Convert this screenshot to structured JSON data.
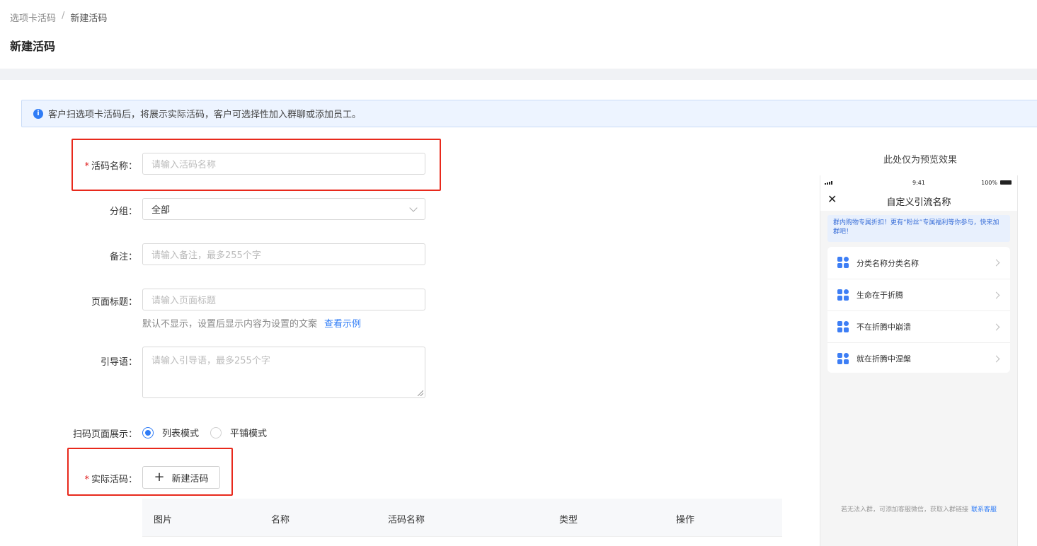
{
  "breadcrumb": {
    "parent": "选项卡活码",
    "separator": "/",
    "current": "新建活码"
  },
  "page_title": "新建活码",
  "banner": {
    "icon": "info-icon",
    "text": "客户扫选项卡活码后，将展示实际活码，客户可选择性加入群聊或添加员工。"
  },
  "form": {
    "name": {
      "label": "活码名称",
      "placeholder": "请输入活码名称",
      "required": true
    },
    "group": {
      "label": "分组",
      "value": "全部"
    },
    "remark": {
      "label": "备注",
      "placeholder": "请输入备注，最多255个字"
    },
    "page_title": {
      "label": "页面标题",
      "placeholder": "请输入页面标题",
      "hint": "默认不显示，设置后显示内容为设置的文案",
      "hint_link": "查看示例"
    },
    "guide": {
      "label": "引导语",
      "placeholder": "请输入引导语，最多255个字"
    },
    "display_mode": {
      "label": "扫码页面展示",
      "options": [
        "列表模式",
        "平铺模式"
      ],
      "selected": "列表模式"
    },
    "actual_code": {
      "label": "实际活码",
      "button": "新建活码",
      "required": true
    },
    "colon": "："
  },
  "table": {
    "columns": [
      "图片",
      "名称",
      "活码名称",
      "类型",
      "操作"
    ]
  },
  "preview": {
    "caption": "此处仅为预览效果",
    "status_time": "9:41",
    "status_battery": "100%",
    "title": "自定义引流名称",
    "banner": "群内购物专属折扣！更有“粉丝”专属福利等你参与，快来加群吧！",
    "items": [
      "分类名称分类名称",
      "生命在于折腾",
      "不在折腾中崩溃",
      "就在折腾中涅槃"
    ],
    "footer": "若无法入群，可添加客服微信，获取入群链接",
    "footer_link": "联系客服"
  },
  "colors": {
    "accent": "#2f7cf6",
    "highlight_box": "#e8291c",
    "required": "#e02020"
  }
}
